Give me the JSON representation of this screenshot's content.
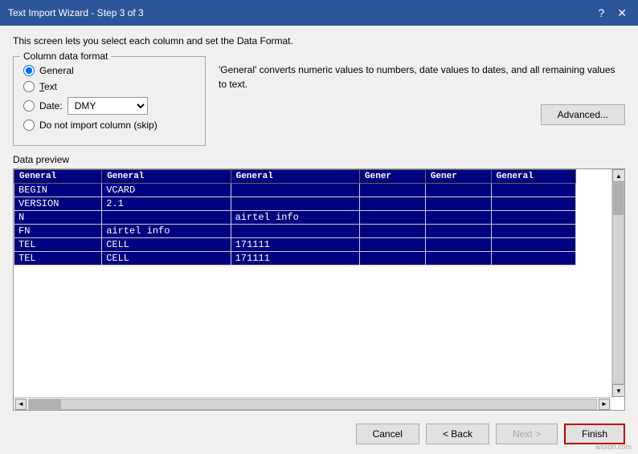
{
  "titleBar": {
    "title": "Text Import Wizard - Step 3 of 3",
    "helpBtn": "?",
    "closeBtn": "✕"
  },
  "introText": "This screen lets you select each column and set the Data Format.",
  "columnDataFormat": {
    "legend": "Column data format",
    "options": [
      {
        "id": "general",
        "label": "General",
        "checked": true
      },
      {
        "id": "text",
        "label": "Text",
        "underlineChar": "T",
        "checked": false
      },
      {
        "id": "date",
        "label": "Date:",
        "checked": false
      },
      {
        "id": "skip",
        "label": "Do not import column (skip)",
        "checked": false
      }
    ],
    "dateValue": "DMY"
  },
  "description": "'General' converts numeric values to numbers, date values to dates, and all remaining values to text.",
  "advancedBtn": "Advanced...",
  "dataPreview": {
    "label": "Data preview",
    "headers": [
      "General",
      "General",
      "General",
      "Gener",
      "Gener",
      "General"
    ],
    "rows": [
      [
        "BEGIN",
        "VCARD",
        "",
        "",
        "",
        ""
      ],
      [
        "VERSION",
        "2.1",
        "",
        "",
        "",
        ""
      ],
      [
        "N",
        "",
        "airtel info",
        "",
        "",
        ""
      ],
      [
        "FN",
        "airtel info",
        "",
        "",
        "",
        ""
      ],
      [
        "TEL",
        "CELL",
        "171111",
        "",
        "",
        ""
      ],
      [
        "TEL",
        "CELL",
        "171111",
        "",
        "",
        ""
      ]
    ]
  },
  "buttons": {
    "cancel": "Cancel",
    "back": "< Back",
    "next": "Next >",
    "finish": "Finish"
  },
  "watermark": "wsxdn.com"
}
